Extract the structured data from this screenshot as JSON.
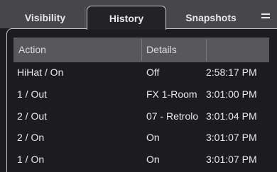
{
  "tabs": [
    {
      "label": "Visibility",
      "active": false
    },
    {
      "label": "History",
      "active": true
    },
    {
      "label": "Snapshots",
      "active": false
    }
  ],
  "table": {
    "columns": [
      "Action",
      "Details",
      ""
    ],
    "rows": [
      {
        "action": "HiHat / On",
        "details": "Off",
        "time": "2:58:17 PM"
      },
      {
        "action": "1 / Out",
        "details": "FX 1-Room",
        "time": "3:01:00 PM"
      },
      {
        "action": "2 / Out",
        "details": "07 - Retrolo",
        "time": "3:01:04 PM"
      },
      {
        "action": "2 / On",
        "details": "On",
        "time": "3:01:07 PM"
      },
      {
        "action": "1 / On",
        "details": "On",
        "time": "3:01:07 PM"
      }
    ]
  },
  "colors": {
    "tabbar": "#474749",
    "panel": "#1c1c1e",
    "header": "#58585a",
    "text": "#eaeaea"
  }
}
